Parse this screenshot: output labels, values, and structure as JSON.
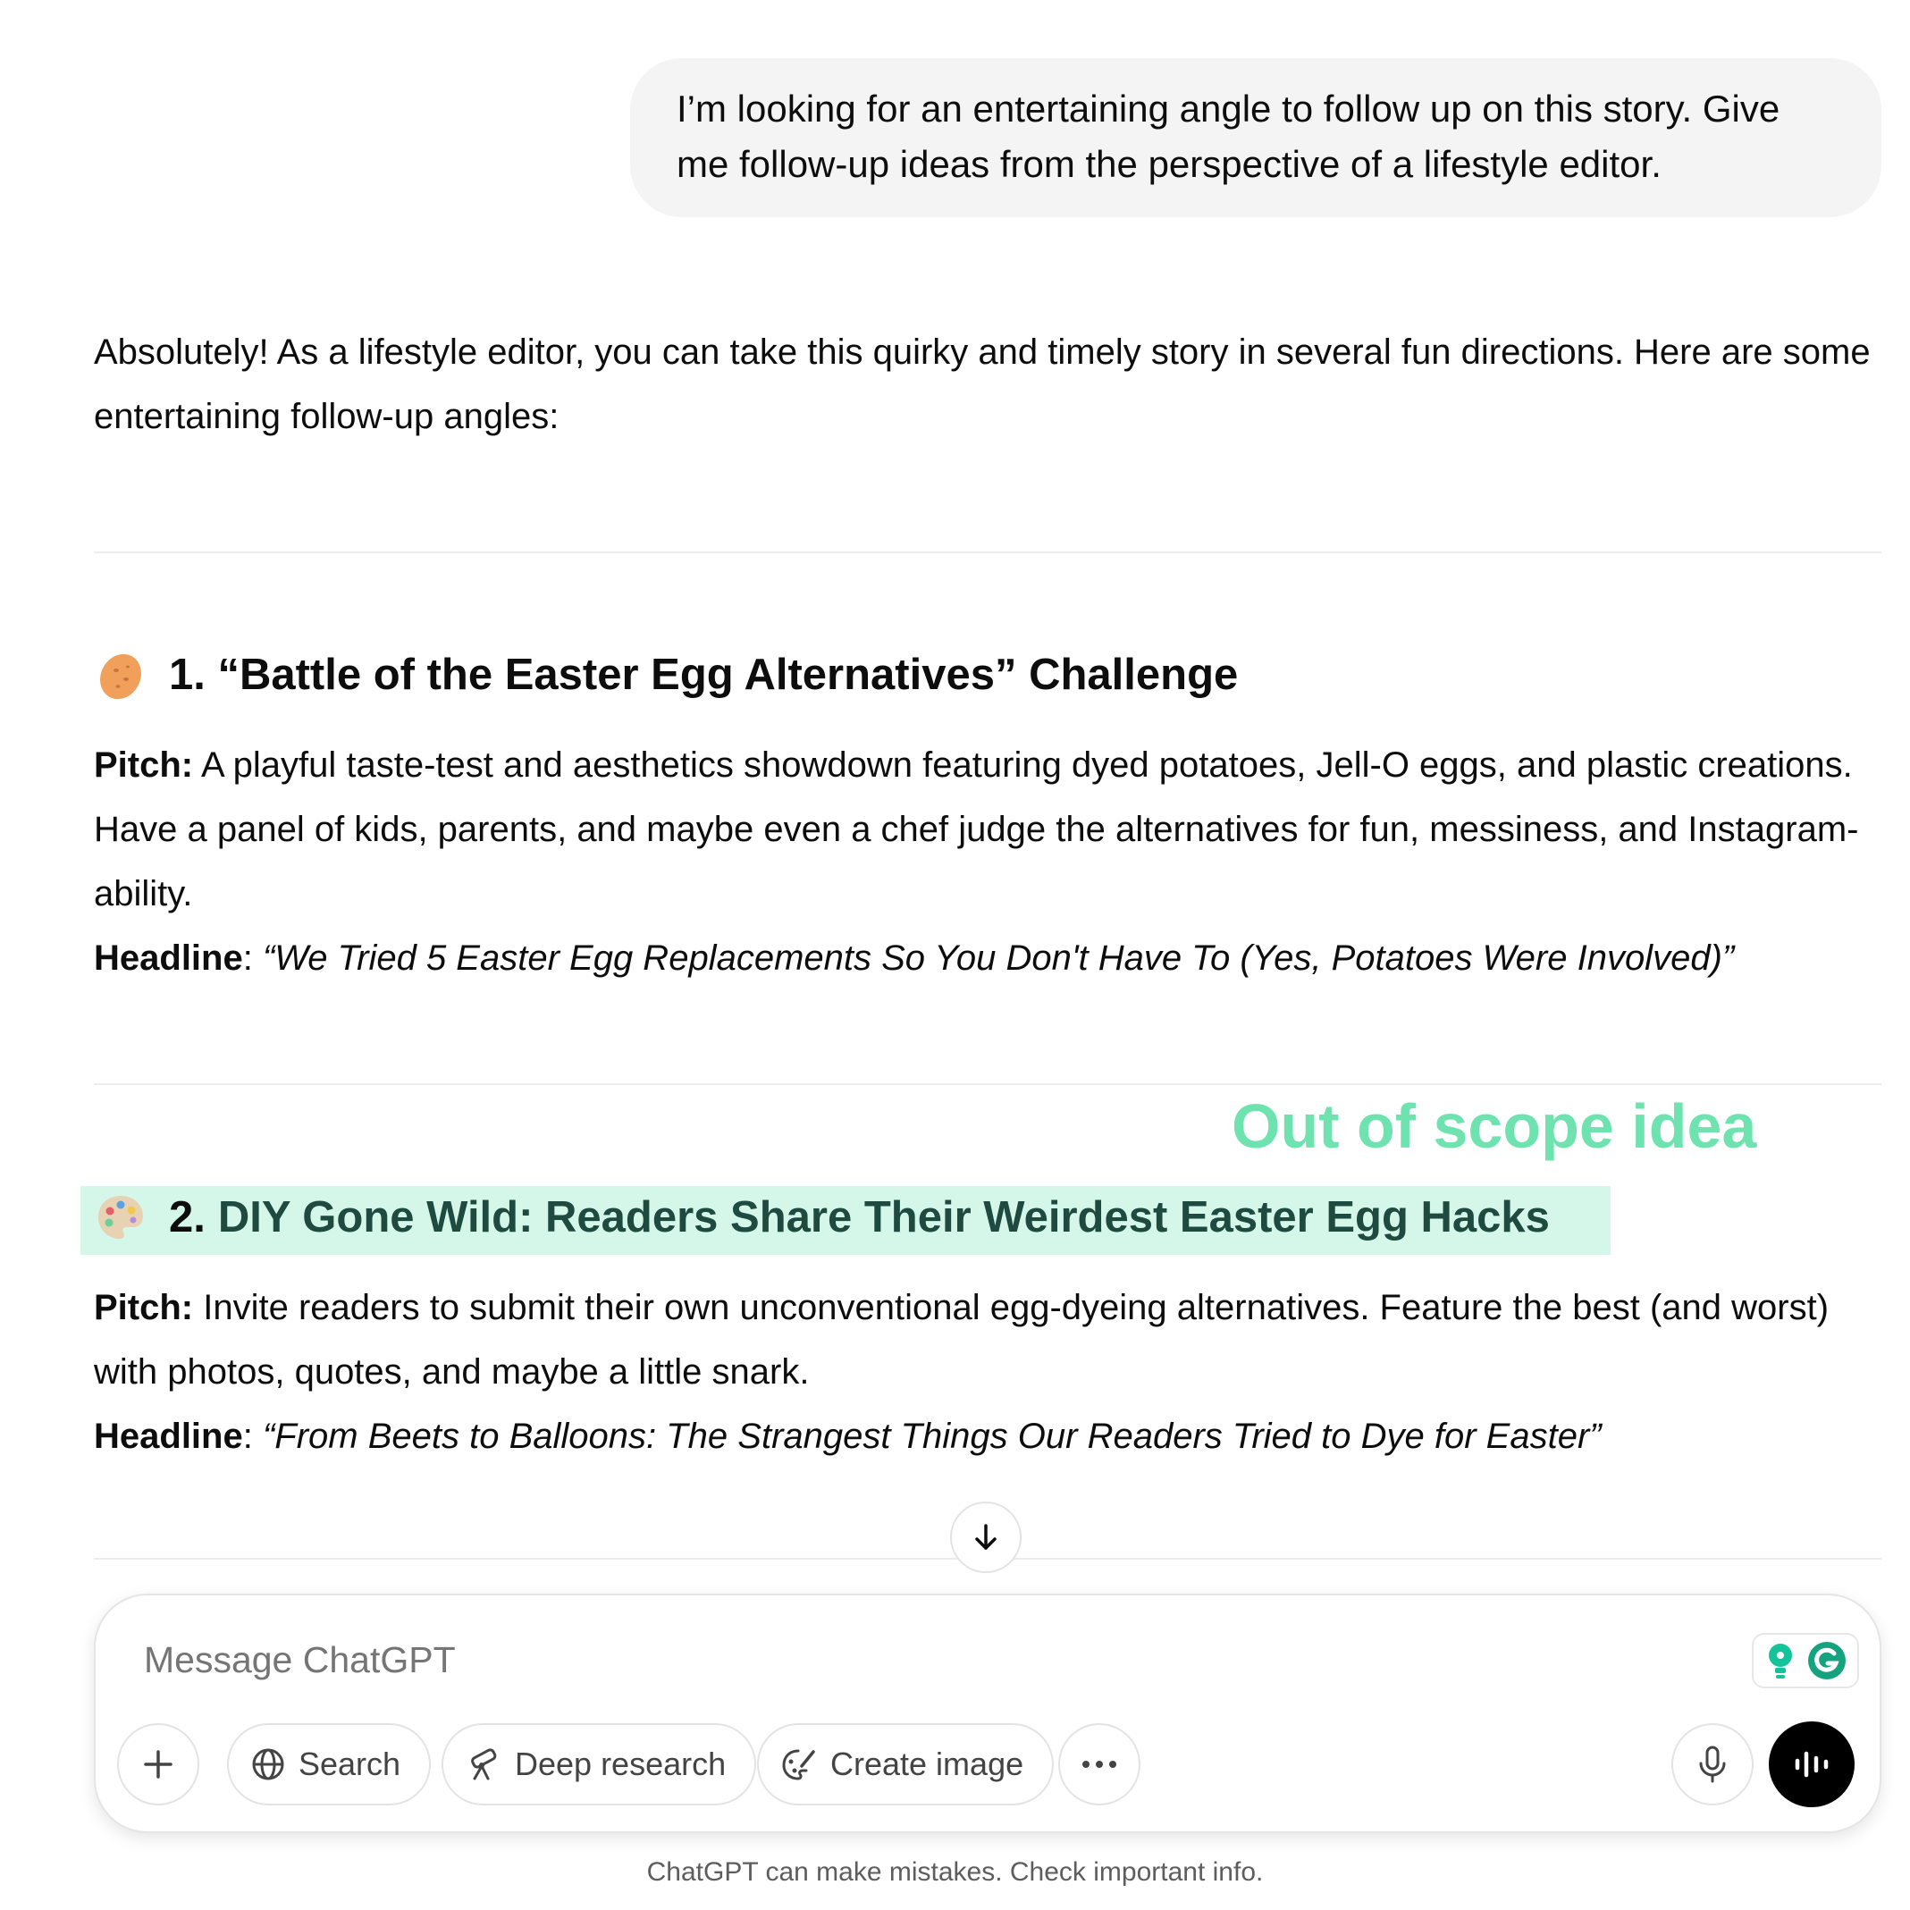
{
  "user_message": {
    "line1": "I’m looking for an entertaining angle to follow up on this story. Give",
    "line2": "me follow-up ideas from the perspective of a lifestyle editor."
  },
  "assistant": {
    "intro": "Absolutely! As a lifestyle editor, you can take this quirky and timely story in several fun directions. Here are some entertaining follow-up angles:",
    "sections": [
      {
        "emoji_name": "potato-icon",
        "heading": "1. “Battle of the Easter Egg Alternatives” Challenge",
        "pitch_label": "Pitch:",
        "pitch_text": " A playful taste-test and aesthetics showdown featuring dyed potatoes, Jell-O eggs, and plastic creations. Have a panel of kids, parents, and maybe even a chef judge the alternatives for fun, messiness, and Instagram-ability.",
        "headline_label": "Headline",
        "headline_text": "“We Tried 5 Easter Egg Replacements So You Don't Have To (Yes, Potatoes Were Involved)”"
      },
      {
        "emoji_name": "palette-icon",
        "heading_number": "2.",
        "heading": "DIY Gone Wild: Readers Share Their Weirdest Easter Egg Hacks",
        "pitch_label": "Pitch:",
        "pitch_text": " Invite readers to submit their own unconventional egg-dyeing alternatives. Feature the best (and worst) with photos, quotes, and maybe a little snark.",
        "headline_label": "Headline",
        "headline_text": "“From Beets to Balloons: The Strangest Things Our Readers Tried to Dye for Easter”"
      }
    ]
  },
  "annotation": {
    "text": "Out of scope idea",
    "color": "#6ee3b0",
    "highlight_color": "#d4f7ea"
  },
  "composer": {
    "placeholder": "Message ChatGPT",
    "buttons": {
      "search": "Search",
      "deep_research": "Deep research",
      "create_image": "Create image"
    }
  },
  "footer": {
    "note": "ChatGPT can make mistakes. Check important info."
  }
}
